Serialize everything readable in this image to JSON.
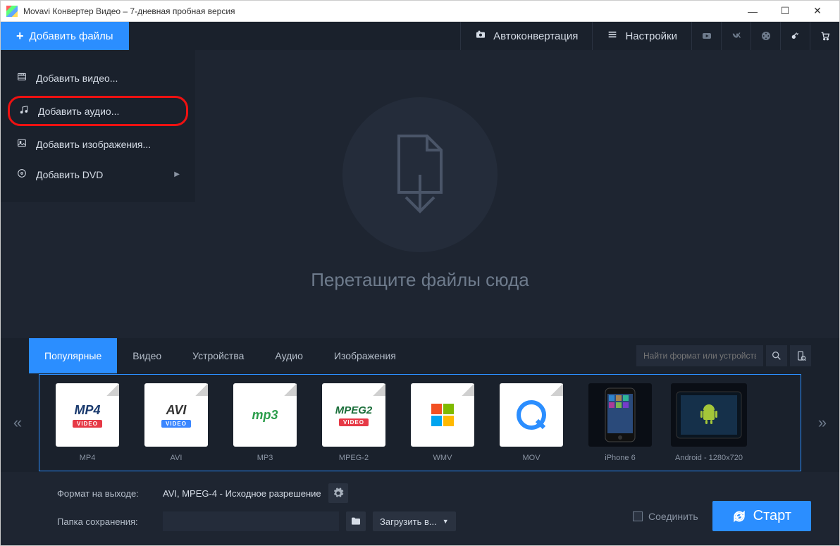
{
  "titlebar": {
    "title": "Movavi Конвертер Видео – 7-дневная пробная версия"
  },
  "toolbar": {
    "add_files": "Добавить файлы",
    "autoconvert": "Автоконвертация",
    "settings": "Настройки"
  },
  "dropdown": {
    "add_video": "Добавить видео...",
    "add_audio": "Добавить аудио...",
    "add_images": "Добавить изображения...",
    "add_dvd": "Добавить DVD"
  },
  "dropzone": {
    "text": "Перетащите файлы сюда"
  },
  "format_tabs": {
    "popular": "Популярные",
    "video": "Видео",
    "devices": "Устройства",
    "audio": "Аудио",
    "images": "Изображения"
  },
  "search": {
    "placeholder": "Найти формат или устройств..."
  },
  "formats": [
    {
      "badge": "MP4",
      "sub": "VIDEO",
      "sub_color": "red",
      "label": "MP4"
    },
    {
      "badge": "AVI",
      "sub": "VIDEO",
      "sub_color": "blue",
      "label": "AVI"
    },
    {
      "badge": "mp3",
      "sub": "",
      "sub_color": "",
      "label": "MP3"
    },
    {
      "badge": "MPEG2",
      "sub": "VIDEO",
      "sub_color": "red",
      "label": "MPEG-2"
    },
    {
      "badge": "",
      "sub": "",
      "sub_color": "",
      "label": "WMV"
    },
    {
      "badge": "Q",
      "sub": "",
      "sub_color": "",
      "label": "MOV"
    },
    {
      "badge": "",
      "sub": "",
      "sub_color": "",
      "label": "iPhone 6"
    },
    {
      "badge": "",
      "sub": "",
      "sub_color": "",
      "label": "Android - 1280x720"
    }
  ],
  "bottom": {
    "output_format_label": "Формат на выходе:",
    "output_format_value": "AVI, MPEG-4 - Исходное разрешение",
    "save_folder_label": "Папка сохранения:",
    "upload_to": "Загрузить в...",
    "join": "Соединить",
    "start": "Старт"
  }
}
